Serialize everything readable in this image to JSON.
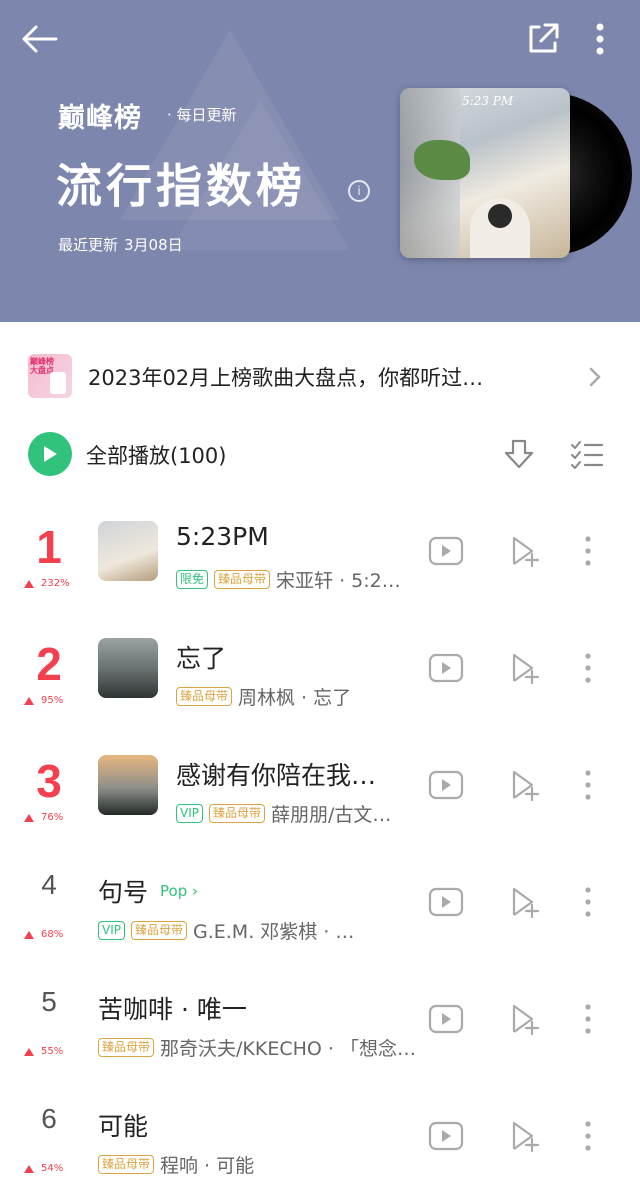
{
  "header": {
    "brand": "巅峰榜",
    "brand_sub": "· 每日更新",
    "title": "流行指数榜",
    "updated_label": "最近更新",
    "updated_date": "3月08日",
    "cover_text": "5:23 PM",
    "bg_color": "#7d86ad"
  },
  "icons": {
    "back": "back-arrow-icon",
    "share": "share-icon",
    "more": "more-vertical-icon"
  },
  "banner": {
    "thumb_text": "巅峰榜\n大盘点",
    "text": "2023年02月上榜歌曲大盘点，你都听过…"
  },
  "playall": {
    "label": "全部播放(100)"
  },
  "accent_color": "#31c27c",
  "rank_color": "#f2404f",
  "songs": [
    {
      "rank": "1",
      "trend": "232%",
      "title": "5:23PM",
      "tags": [
        "限免",
        "臻品母带"
      ],
      "artist": "宋亚轩 · 5:2…",
      "pop": ""
    },
    {
      "rank": "2",
      "trend": "95%",
      "title": "忘了",
      "tags": [
        "臻品母带"
      ],
      "artist": "周林枫 · 忘了",
      "pop": ""
    },
    {
      "rank": "3",
      "trend": "76%",
      "title": "感谢有你陪在我…",
      "tags": [
        "VIP",
        "臻品母带"
      ],
      "artist": "薛朋朋/古文…",
      "pop": ""
    },
    {
      "rank": "4",
      "trend": "68%",
      "title": "句号",
      "tags": [
        "VIP",
        "臻品母带"
      ],
      "artist": "G.E.M. 邓紫棋 · …",
      "pop": "Pop"
    },
    {
      "rank": "5",
      "trend": "55%",
      "title": "苦咖啡 · 唯一",
      "tags": [
        "臻品母带"
      ],
      "artist": "那奇沃夫/KKECHO · 「想念…",
      "pop": ""
    },
    {
      "rank": "6",
      "trend": "54%",
      "title": "可能",
      "tags": [
        "臻品母带"
      ],
      "artist": "程响 · 可能",
      "pop": ""
    }
  ]
}
